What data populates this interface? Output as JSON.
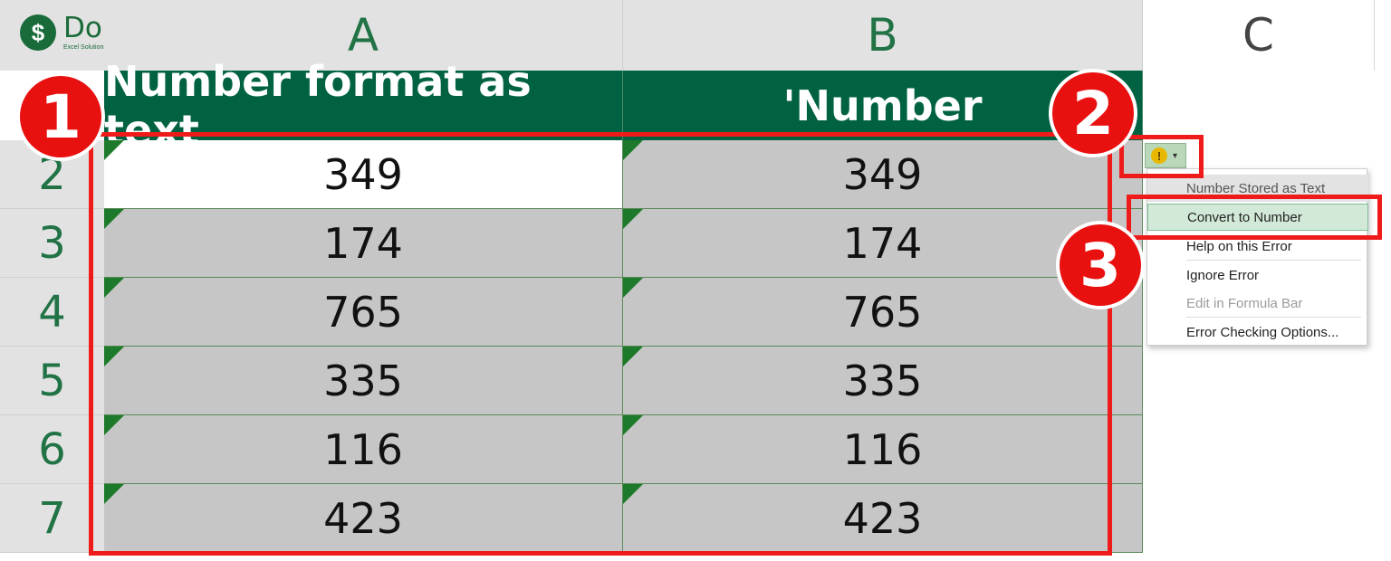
{
  "logo": {
    "title": "Dollar Excel",
    "subtitle": "Excel Solutions For Busy Professionals",
    "symbol": "$"
  },
  "columns": [
    "A",
    "B",
    "C"
  ],
  "rows": [
    "2",
    "3",
    "4",
    "5",
    "6",
    "7"
  ],
  "header_row": {
    "a": "Number format as text",
    "b": "'Number"
  },
  "data": [
    {
      "a": "349",
      "b": "349"
    },
    {
      "a": "174",
      "b": "174"
    },
    {
      "a": "765",
      "b": "765"
    },
    {
      "a": "335",
      "b": "335"
    },
    {
      "a": "116",
      "b": "116"
    },
    {
      "a": "423",
      "b": "423"
    }
  ],
  "badges": [
    "1",
    "2",
    "3"
  ],
  "smart_tag": {
    "icon": "warning-icon",
    "glyph": "!",
    "chevron": "▾"
  },
  "menu": {
    "heading": "Number Stored as Text",
    "items": [
      {
        "label": "Convert to Number",
        "state": "highlighted"
      },
      {
        "label": "Help on this Error",
        "state": "normal"
      },
      {
        "label": "Ignore Error",
        "state": "normal"
      },
      {
        "label": "Edit in Formula Bar",
        "state": "disabled"
      },
      {
        "label": "Error Checking Options...",
        "state": "normal"
      }
    ]
  },
  "colors": {
    "header_green": "#006241",
    "accent_red": "#ef1b1b",
    "grid_text_green": "#217346"
  }
}
